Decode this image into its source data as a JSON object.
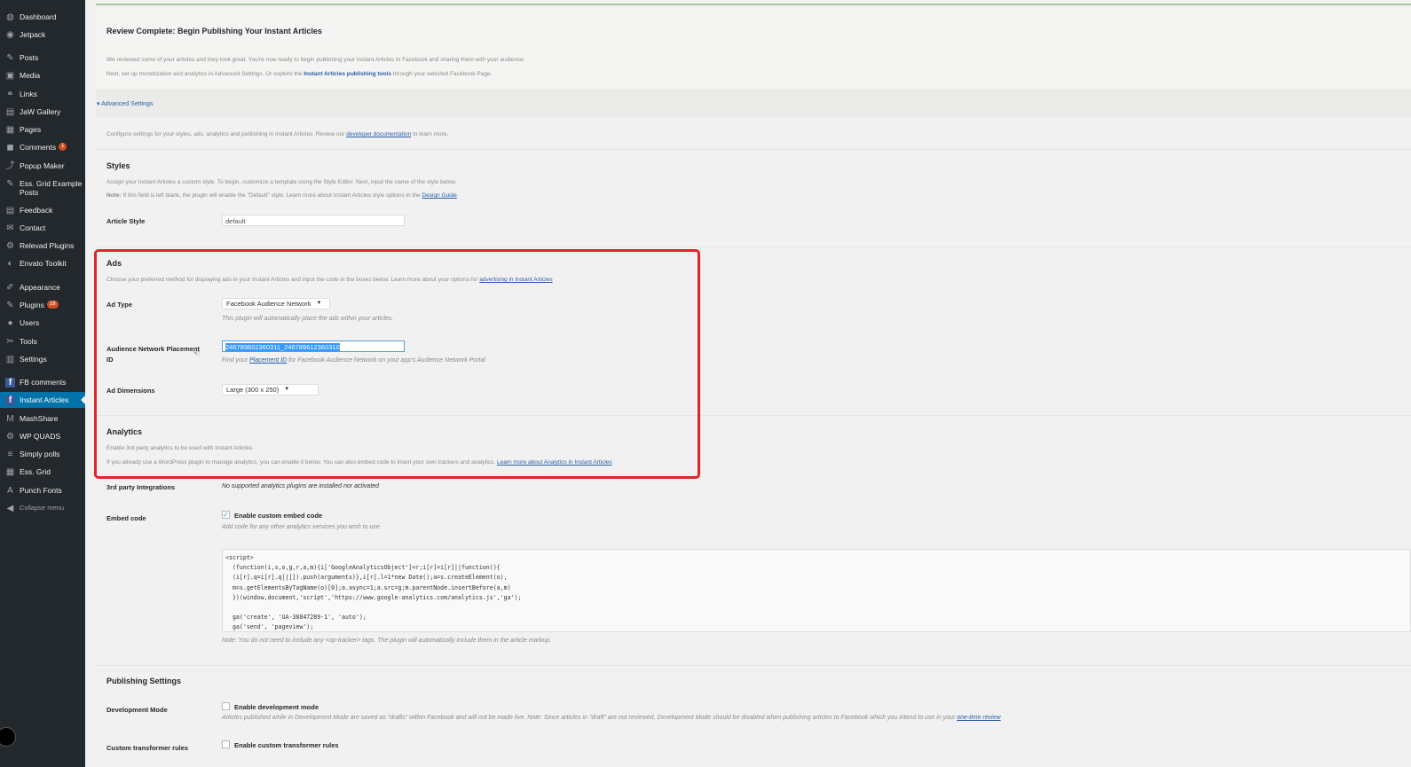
{
  "sidebar": {
    "items": [
      {
        "label": "Dashboard",
        "icon": "dashboard-icon"
      },
      {
        "label": "Jetpack",
        "icon": "jetpack-icon"
      },
      {
        "label": "Posts",
        "icon": "pin-icon"
      },
      {
        "label": "Media",
        "icon": "media-icon"
      },
      {
        "label": "Links",
        "icon": "link-icon"
      },
      {
        "label": "JaW Gallery",
        "icon": "gallery-icon"
      },
      {
        "label": "Pages",
        "icon": "page-icon"
      },
      {
        "label": "Comments",
        "icon": "comment-icon",
        "badge": "1"
      },
      {
        "label": "Popup Maker",
        "icon": "popup-icon"
      },
      {
        "label": "Ess. Grid Example Posts",
        "icon": "pin-icon"
      },
      {
        "label": "Feedback",
        "icon": "feedback-icon"
      },
      {
        "label": "Contact",
        "icon": "mail-icon"
      },
      {
        "label": "Relevad Plugins",
        "icon": "gear-icon"
      },
      {
        "label": "Envato Toolkit",
        "icon": "envato-icon"
      },
      {
        "label": "Appearance",
        "icon": "brush-icon"
      },
      {
        "label": "Plugins",
        "icon": "plugin-icon",
        "badge": "18"
      },
      {
        "label": "Users",
        "icon": "user-icon"
      },
      {
        "label": "Tools",
        "icon": "wrench-icon"
      },
      {
        "label": "Settings",
        "icon": "settings-icon"
      },
      {
        "label": "FB comments",
        "icon": "facebook-icon"
      },
      {
        "label": "Instant Articles",
        "icon": "facebook-icon"
      },
      {
        "label": "MashShare",
        "icon": "mashshare-icon"
      },
      {
        "label": "WP QUADS",
        "icon": "gear-icon"
      },
      {
        "label": "Simply polls",
        "icon": "poll-icon"
      },
      {
        "label": "Ess. Grid",
        "icon": "grid-icon"
      },
      {
        "label": "Punch Fonts",
        "icon": "font-icon"
      },
      {
        "label": "Collapse menu",
        "icon": "collapse-icon"
      }
    ]
  },
  "notice": {
    "title": "Review Complete: Begin Publishing Your Instant Articles",
    "line1": "We reviewed some of your articles and they look great. You're now ready to begin publishing your Instant Articles to Facebook and sharing them with your audience.",
    "line2_pre": "Next, set up monetization and analytics in Advanced Settings. Or explore the ",
    "line2_link": "Instant Articles publishing tools",
    "line2_post": " through your selected Facebook Page."
  },
  "advanced": {
    "toggle": "▾ Advanced Settings",
    "intro_pre": "Configure settings for your styles, ads, analytics and publishing in Instant Articles. Review our ",
    "intro_link": "developer documentation",
    "intro_post": " to learn more."
  },
  "styles": {
    "title": "Styles",
    "desc1": "Assign your Instant Articles a custom style. To begin, customize a template using the Style Editor. Next, input the name of the style below.",
    "desc2_bold": "Note:",
    "desc2": " If this field is left blank, the plugin will enable the \"Default\" style. Learn more about Instant Articles style options in the ",
    "desc2_link": "Design Guide",
    "desc2_end": ".",
    "article_style_label": "Article Style",
    "article_style_value": "default"
  },
  "ads": {
    "title": "Ads",
    "desc_pre": "Choose your preferred method for displaying ads in your Instant Articles and input the code in the boxes below. Learn more about your options for ",
    "desc_link": "advertising in Instant Articles",
    "ad_type_label": "Ad Type",
    "ad_type_value": "Facebook Audience Network",
    "ad_type_help": "This plugin will automatically place the ads within your articles.",
    "placement_label_1": "Audience Network Placement",
    "placement_label_2": "ID",
    "placement_value": "246789602360311_246789612360310",
    "placement_help_pre": "Find your ",
    "placement_help_link": "Placement ID",
    "placement_help_post": " for Facebook Audience Network on your app's Audience Network Portal",
    "dimensions_label": "Ad Dimensions",
    "dimensions_value": "Large (300 x 250)"
  },
  "analytics": {
    "title": "Analytics",
    "desc1": "Enable 3rd party analytics to be used with Instant Articles",
    "desc2_pre": "If you already use a WordPress plugin to manage analytics, you can enable it below. You can also embed code to insert your own trackers and analytics. ",
    "desc2_link": "Learn more about Analytics in Instant Articles",
    "third_party_label": "3rd party Integrations",
    "third_party_value": "No supported analytics plugins are installed nor activated",
    "embed_label": "Embed code",
    "embed_checkbox": "Enable custom embed code",
    "embed_help": "Add code for any other analytics services you wish to use.",
    "code": "<script>\n  (function(i,s,o,g,r,a,m){i['GoogleAnalyticsObject']=r;i[r]=i[r]||function(){\n  (i[r].q=i[r].q||[]).push(arguments)},i[r].l=1*new Date();a=s.createElement(o),\n  m=s.getElementsByTagName(o)[0];a.async=1;a.src=g;m.parentNode.insertBefore(a,m)\n  })(window,document,'script','https://www.google-analytics.com/analytics.js','ga');\n\n  ga('create', 'UA-38847289-1', 'auto');\n  ga('send', 'pageview');",
    "note": "Note: You do not need to include any <op-tracker> tags. The plugin will automatically include them in the article markup."
  },
  "publishing": {
    "title": "Publishing Settings",
    "dev_label": "Development Mode",
    "dev_checkbox": "Enable development mode",
    "dev_help_pre": "Articles published while in Development Mode are saved as \"drafts\" within Facebook and will not be made live. Note: Since articles in \"draft\" are not reviewed, Development Mode should be disabled when publishing articles to Facebook which you intend to use in your ",
    "dev_help_link": "one-time review",
    "transformer_label": "Custom transformer rules",
    "transformer_checkbox": "Enable custom transformer rules"
  },
  "colors": {
    "sidebar_bg": "#23282d",
    "current_item": "#0073aa",
    "highlight_border": "#e0242a",
    "link": "#2a5ea8"
  }
}
